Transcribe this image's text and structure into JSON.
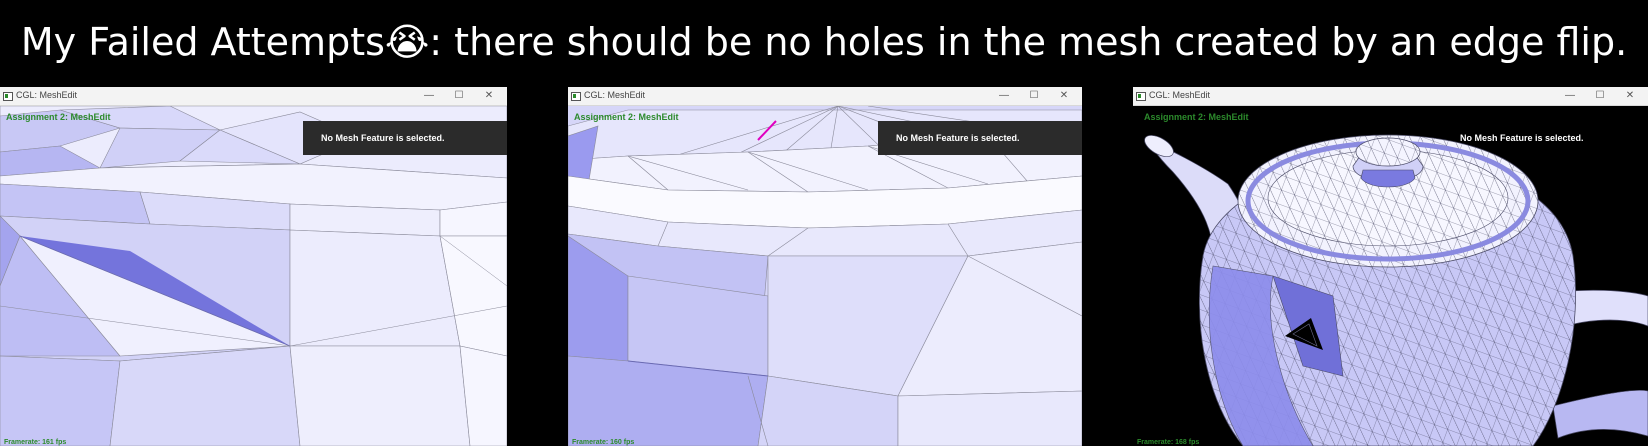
{
  "heading": {
    "text_before": "My Failed Attempts",
    "emoji": "😭",
    "text_after": ": there should be no holes in the mesh created by an edge flip."
  },
  "windows": [
    {
      "title": "CGL: MeshEdit",
      "app_label": "Assignment 2: MeshEdit",
      "status": "No Mesh Feature is selected.",
      "framerate": "Framerate: 161 fps",
      "controls": {
        "minimize": "—",
        "maximize": "☐",
        "close": "✕"
      }
    },
    {
      "title": "CGL: MeshEdit",
      "app_label": "Assignment 2: MeshEdit",
      "status": "No Mesh Feature is selected.",
      "framerate": "Framerate: 160 fps",
      "controls": {
        "minimize": "—",
        "maximize": "☐",
        "close": "✕"
      }
    },
    {
      "title": "CGL: MeshEdit",
      "app_label": "Assignment 2: MeshEdit",
      "status": "No Mesh Feature is selected.",
      "framerate": "Framerate: 168 fps",
      "controls": {
        "minimize": "—",
        "maximize": "☐",
        "close": "✕"
      }
    }
  ],
  "colors": {
    "hud_green": "#2c8a2c",
    "mesh_light": "#e2e2fb",
    "mesh_mid": "#c6c6f5",
    "mesh_dark": "#8c8cec",
    "mesh_hole": "#7474dc",
    "highlight_edge": "#e000c0"
  }
}
